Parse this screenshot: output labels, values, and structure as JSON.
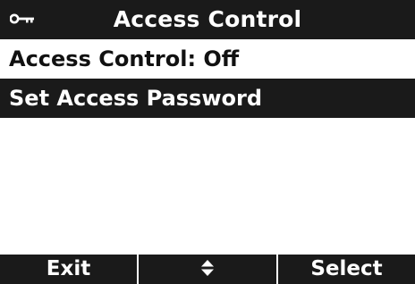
{
  "header": {
    "icon": "key-icon",
    "title": "Access Control"
  },
  "menu": {
    "items": [
      {
        "label": "Access Control: Off",
        "selected": false
      },
      {
        "label": "Set Access Password",
        "selected": true
      }
    ]
  },
  "softkeys": {
    "left": "Exit",
    "middle_icon": "up-down-arrows-icon",
    "right": "Select"
  },
  "colors": {
    "foreground_dark": "#1a1a1a",
    "background": "#ffffff"
  }
}
